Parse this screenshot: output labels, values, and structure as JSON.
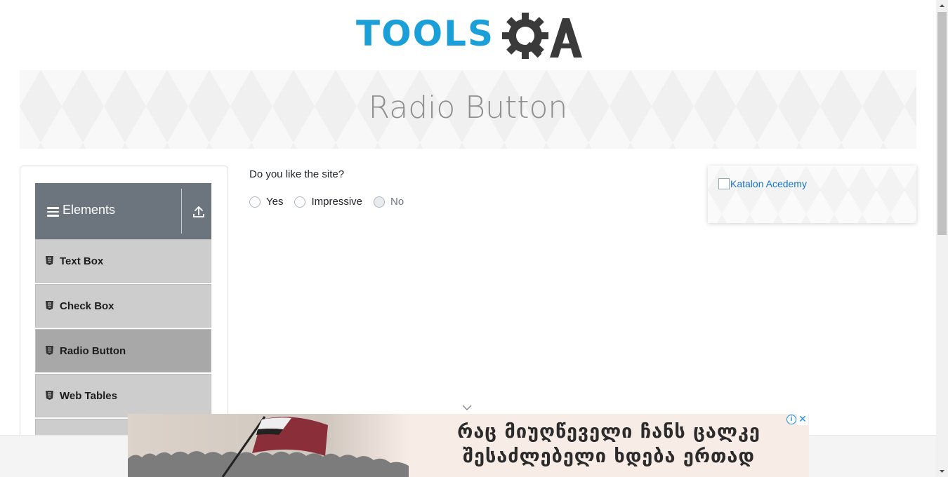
{
  "logo": {
    "text": "TOOLS",
    "suffix": "QA"
  },
  "banner": {
    "title": "Radio Button"
  },
  "sidebar": {
    "group_title": "Elements",
    "items": [
      {
        "label": "Text Box",
        "active": false
      },
      {
        "label": "Check Box",
        "active": false
      },
      {
        "label": "Radio Button",
        "active": true
      },
      {
        "label": "Web Tables",
        "active": false
      }
    ]
  },
  "content": {
    "question": "Do you like the site?",
    "options": [
      {
        "label": "Yes",
        "disabled": false
      },
      {
        "label": "Impressive",
        "disabled": false
      },
      {
        "label": "No",
        "disabled": true
      }
    ]
  },
  "side_ad": {
    "alt_text": "Katalon Acedemy"
  },
  "bottom_ad": {
    "line1": "რაც მიუღწეველი ჩანს ცალკე",
    "line2": "შესაძლებელი ხდება ერთად",
    "info": "i",
    "close": "✕"
  },
  "colors": {
    "brand_blue": "#1a9fd8",
    "brand_dark": "#3a3a3a",
    "header_gray": "#6c757d",
    "menu_item": "#cdcdcd",
    "menu_active": "#a8a8a8"
  }
}
